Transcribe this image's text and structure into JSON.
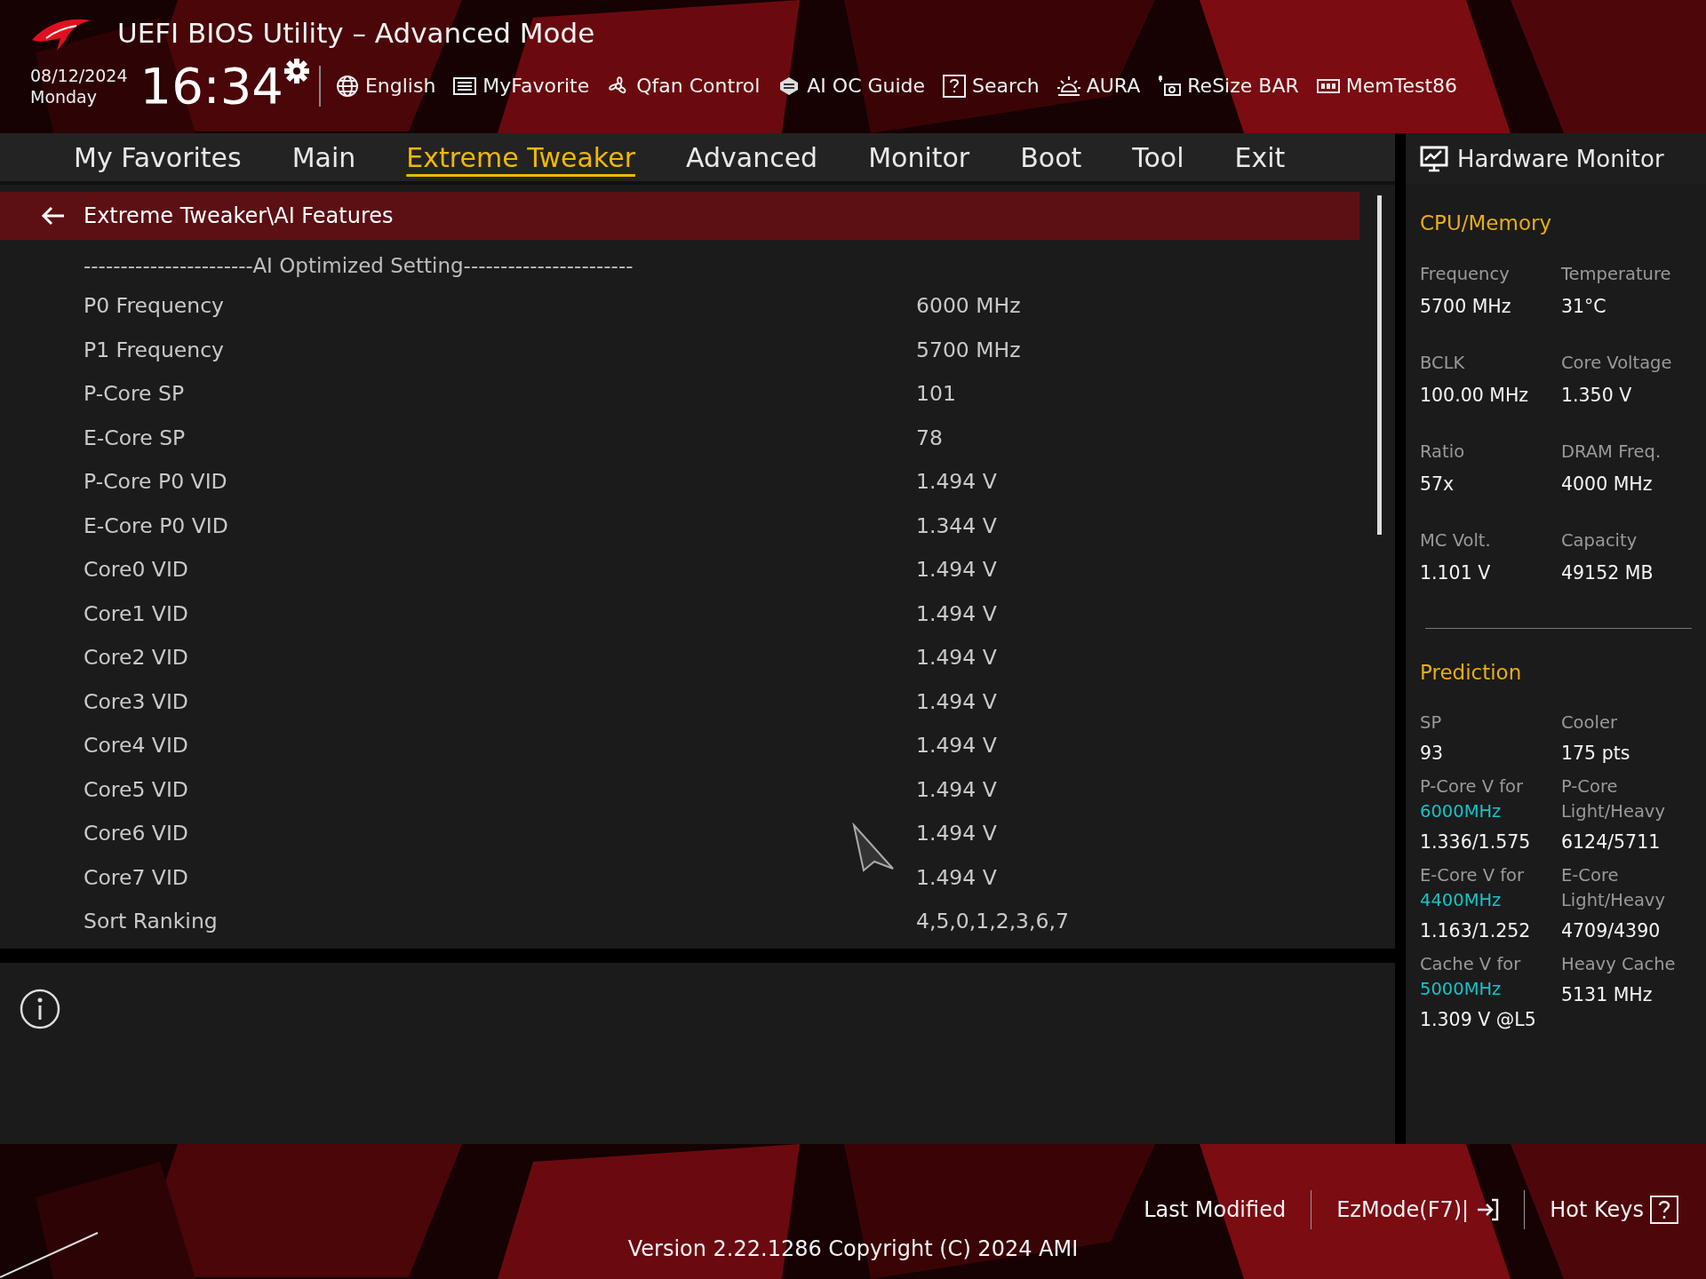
{
  "header": {
    "title": "UEFI BIOS Utility – Advanced Mode",
    "date": "08/12/2024",
    "day": "Monday",
    "time": "16:34"
  },
  "toolbar": [
    {
      "label": "English"
    },
    {
      "label": "MyFavorite"
    },
    {
      "label": "Qfan Control"
    },
    {
      "label": "AI OC Guide"
    },
    {
      "label": "Search"
    },
    {
      "label": "AURA"
    },
    {
      "label": "ReSize BAR"
    },
    {
      "label": "MemTest86"
    }
  ],
  "tabs": [
    {
      "label": "My Favorites",
      "selected": false
    },
    {
      "label": "Main",
      "selected": false
    },
    {
      "label": "Extreme Tweaker",
      "selected": true
    },
    {
      "label": "Advanced",
      "selected": false
    },
    {
      "label": "Monitor",
      "selected": false
    },
    {
      "label": "Boot",
      "selected": false
    },
    {
      "label": "Tool",
      "selected": false
    },
    {
      "label": "Exit",
      "selected": false
    }
  ],
  "breadcrumb": "Extreme Tweaker\\AI Features",
  "settings": {
    "heading": "-----------------------AI Optimized Setting-----------------------",
    "rows": [
      {
        "label": "P0 Frequency",
        "value": "6000 MHz"
      },
      {
        "label": "P1 Frequency",
        "value": "5700 MHz"
      },
      {
        "label": "P-Core SP",
        "value": "101"
      },
      {
        "label": "E-Core SP",
        "value": "78"
      },
      {
        "label": "P-Core P0 VID",
        "value": "1.494 V"
      },
      {
        "label": "E-Core P0 VID",
        "value": "1.344 V"
      },
      {
        "label": "Core0 VID",
        "value": "1.494 V"
      },
      {
        "label": "Core1 VID",
        "value": "1.494 V"
      },
      {
        "label": "Core2 VID",
        "value": "1.494 V"
      },
      {
        "label": "Core3 VID",
        "value": "1.494 V"
      },
      {
        "label": "Core4 VID",
        "value": "1.494 V"
      },
      {
        "label": "Core5 VID",
        "value": "1.494 V"
      },
      {
        "label": "Core6 VID",
        "value": "1.494 V"
      },
      {
        "label": "Core7 VID",
        "value": "1.494 V"
      },
      {
        "label": "Sort Ranking",
        "value": "4,5,0,1,2,3,6,7"
      }
    ]
  },
  "hardware_monitor": {
    "title": "Hardware Monitor",
    "sections": [
      {
        "title": "CPU/Memory",
        "items": [
          {
            "label": "Frequency",
            "value": "5700 MHz"
          },
          {
            "label": "Temperature",
            "value": "31°C"
          },
          {
            "label": "BCLK",
            "value": "100.00 MHz"
          },
          {
            "label": "Core Voltage",
            "value": "1.350 V"
          },
          {
            "label": "Ratio",
            "value": "57x"
          },
          {
            "label": "DRAM Freq.",
            "value": "4000 MHz"
          },
          {
            "label": "MC Volt.",
            "value": "1.101 V"
          },
          {
            "label": "Capacity",
            "value": "49152 MB"
          }
        ]
      },
      {
        "title": "Prediction",
        "items": [
          {
            "label": "SP",
            "value": "93"
          },
          {
            "label": "Cooler",
            "value": "175 pts"
          },
          {
            "label": "P-Core V for",
            "highlight": "6000MHz",
            "value": "1.336/1.575"
          },
          {
            "label": "P-Core Light/Heavy",
            "value": "6124/5711"
          },
          {
            "label": "E-Core V for",
            "highlight": "4400MHz",
            "value": "1.163/1.252"
          },
          {
            "label": "E-Core Light/Heavy",
            "value": "4709/4390"
          },
          {
            "label": "Cache V for",
            "highlight": "5000MHz",
            "value": "1.309 V @L5"
          },
          {
            "label": "Heavy Cache",
            "value": "5131 MHz"
          }
        ]
      }
    ]
  },
  "footer": {
    "buttons": [
      {
        "label": "Last Modified"
      },
      {
        "label": "EzMode(F7)|"
      },
      {
        "label": "Hot Keys"
      }
    ],
    "version": "Version 2.22.1286 Copyright (C) 2024 AMI"
  }
}
